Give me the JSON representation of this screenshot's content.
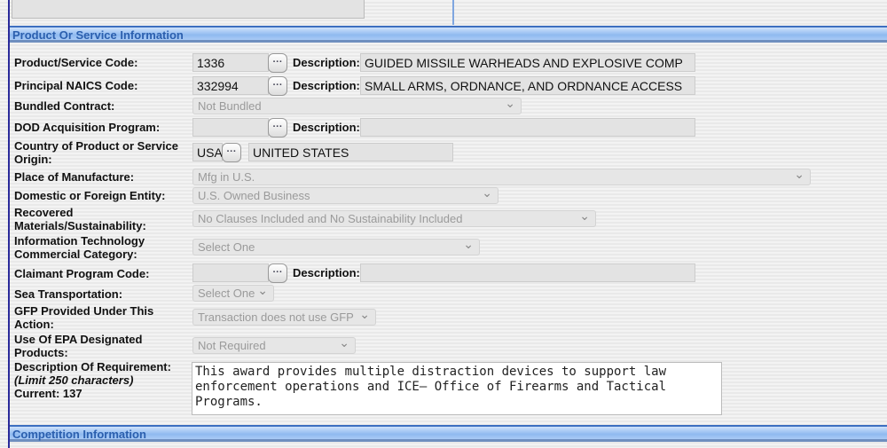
{
  "sections": {
    "product": "Product Or Service Information",
    "competition": "Competition Information"
  },
  "fields": {
    "psc": {
      "label": "Product/Service Code:",
      "value": "1336",
      "desc_label": "Description:",
      "desc": "GUIDED MISSILE WARHEADS AND EXPLOSIVE COMP"
    },
    "naics": {
      "label": "Principal NAICS Code:",
      "value": "332994",
      "desc_label": "Description:",
      "desc": "SMALL ARMS, ORDNANCE, AND ORDNANCE ACCESS"
    },
    "bundled": {
      "label": "Bundled Contract:",
      "value": "Not Bundled"
    },
    "dod": {
      "label": "DOD Acquisition Program:",
      "value": "",
      "desc_label": "Description:",
      "desc": ""
    },
    "country": {
      "label": "Country of Product or Service Origin:",
      "value": "USA",
      "desc": "UNITED STATES"
    },
    "place": {
      "label": "Place of Manufacture:",
      "value": "Mfg in U.S."
    },
    "domestic": {
      "label": "Domestic or Foreign Entity:",
      "value": "U.S. Owned Business"
    },
    "recovered": {
      "label": "Recovered Materials/Sustainability:",
      "value": "No Clauses Included and No Sustainability Included"
    },
    "it": {
      "label": "Information Technology Commercial Category:",
      "value": "Select One"
    },
    "claimant": {
      "label": "Claimant Program Code:",
      "value": "",
      "desc_label": "Description:",
      "desc": ""
    },
    "sea": {
      "label": "Sea Transportation:",
      "value": "Select One"
    },
    "gfp": {
      "label": "GFP Provided Under This Action:",
      "value": "Transaction does not use GFP"
    },
    "epa": {
      "label": "Use Of EPA Designated Products:",
      "value": "Not Required"
    },
    "req": {
      "label": "Description Of Requirement:",
      "limit": "(Limit 250 characters)",
      "current": "Current: 137",
      "value": "This award provides multiple distraction devices to support law\nenforcement operations and ICE– Office of Firearms and Tactical\nPrograms."
    }
  },
  "lookup_icon": "ellipsis-button"
}
